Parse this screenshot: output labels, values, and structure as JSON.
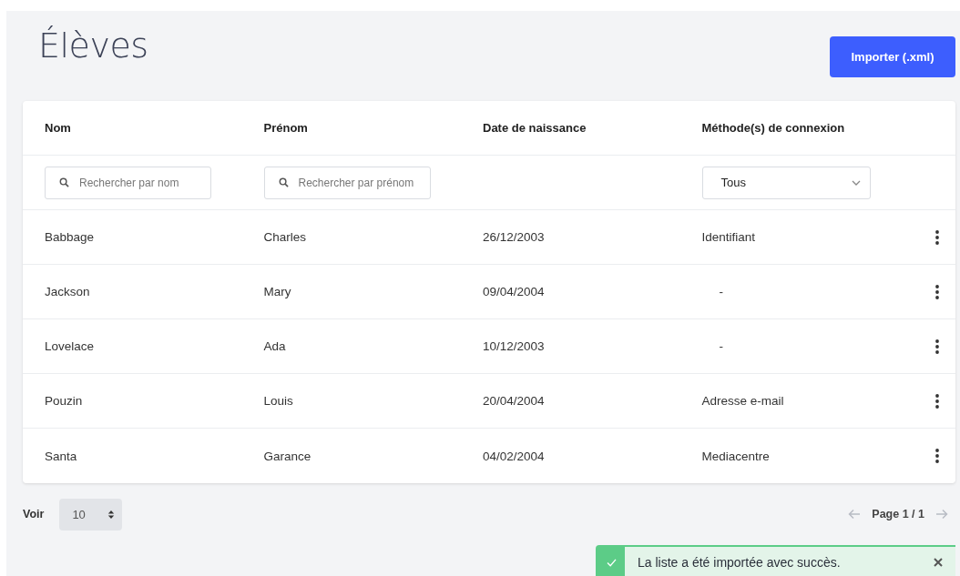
{
  "page": {
    "title": "Élèves"
  },
  "import_button": {
    "label": "Importer (.xml)"
  },
  "table": {
    "columns": [
      "Nom",
      "Prénom",
      "Date de naissance",
      "Méthode(s) de connexion"
    ],
    "filters": {
      "name": {
        "placeholder": "Rechercher par nom"
      },
      "first_name": {
        "placeholder": "Rechercher par prénom"
      },
      "method": {
        "value": "Tous"
      }
    },
    "rows": [
      {
        "nom": "Babbage",
        "prenom": "Charles",
        "date": "26/12/2003",
        "methode": "Identifiant"
      },
      {
        "nom": "Jackson",
        "prenom": "Mary",
        "date": "09/04/2004",
        "methode": "-"
      },
      {
        "nom": "Lovelace",
        "prenom": "Ada",
        "date": "10/12/2003",
        "methode": "-"
      },
      {
        "nom": "Pouzin",
        "prenom": "Louis",
        "date": "20/04/2004",
        "methode": "Adresse e-mail"
      },
      {
        "nom": "Santa",
        "prenom": "Garance",
        "date": "04/02/2004",
        "methode": "Mediacentre"
      }
    ]
  },
  "footer": {
    "show_label": "Voir",
    "page_size": "10",
    "pagination": "Page 1 / 1",
    "prev_disabled": true,
    "next_disabled": true
  },
  "toast": {
    "message": "La liste a été importée avec succès.",
    "kind": "success"
  }
}
